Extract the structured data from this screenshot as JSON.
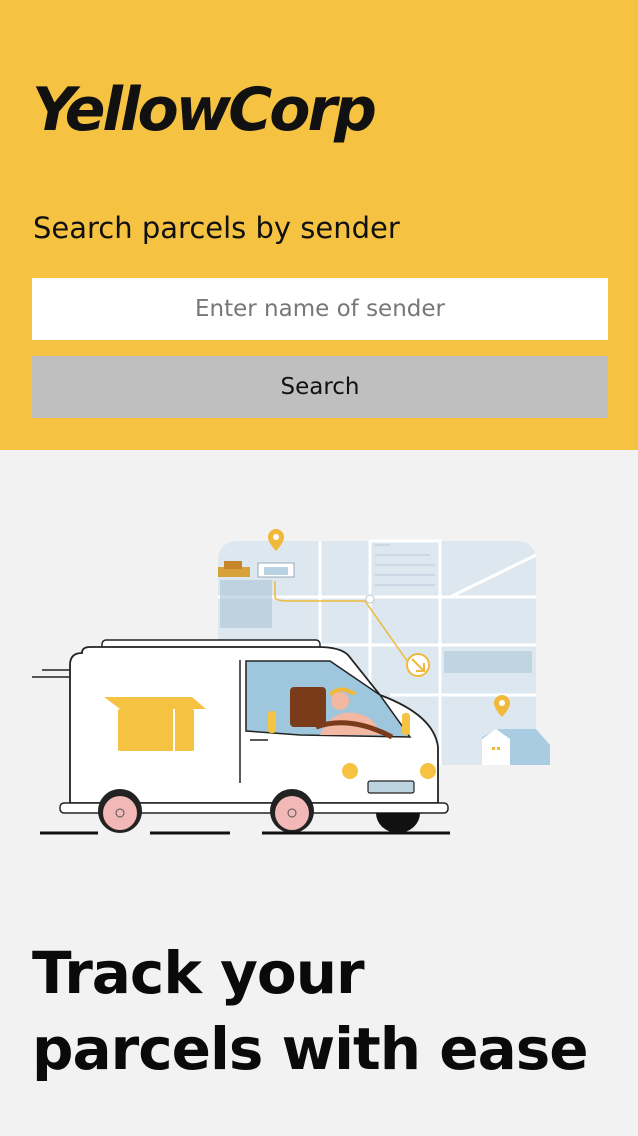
{
  "brand": {
    "name": "YellowCorp"
  },
  "search": {
    "label": "Search parcels by sender",
    "placeholder": "Enter name of sender",
    "button_label": "Search"
  },
  "hero": {
    "tagline": "Track your parcels with ease",
    "illustration_icon": "delivery-van-map-illustration"
  },
  "colors": {
    "brand_yellow": "#f5c242",
    "background": "#f2f2f2",
    "button_gray": "#bfbfbf"
  }
}
